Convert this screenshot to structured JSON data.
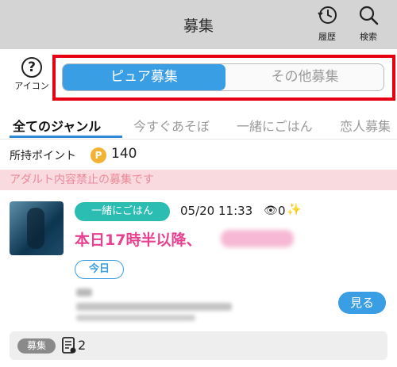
{
  "header": {
    "title": "募集",
    "history_label": "履歴",
    "search_label": "検索"
  },
  "help": {
    "symbol": "?",
    "label": "アイコン"
  },
  "mode_toggle": {
    "options": [
      "ピュア募集",
      "その他募集"
    ],
    "selected": "ピュア募集"
  },
  "genres": {
    "tabs": [
      "全てのジャンル",
      "今すぐあそぼ",
      "一緒にごはん",
      "恋人募集"
    ],
    "active": "全てのジャンル"
  },
  "points": {
    "label": "所持ポイント",
    "icon": "P",
    "value": "140"
  },
  "notice": "アダルト内容禁止の募集です",
  "post": {
    "genre": "一緒にごはん",
    "time": "05/20 11:33",
    "view_icon": "👁",
    "views": "0",
    "sparkle_icon": "✨",
    "title": "本日17時半以降、",
    "day": "今日",
    "view_button": "見る",
    "tag": "募集",
    "doc_count": "2"
  },
  "colors": {
    "accent_blue": "#3a9ee4",
    "highlight_red": "#e60012",
    "teal": "#2bbcb2",
    "pink": "#e8408f",
    "notice_bg": "#f9dadf",
    "point_gold": "#f3b233"
  }
}
